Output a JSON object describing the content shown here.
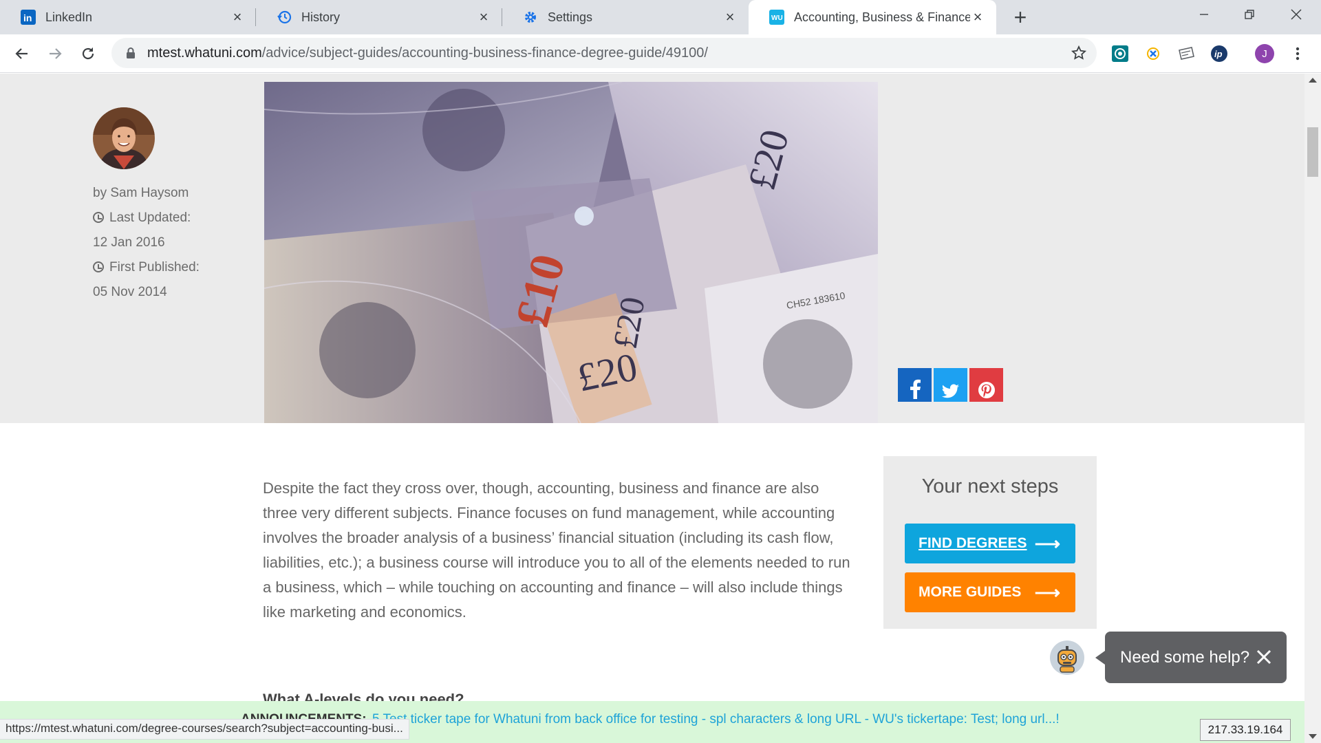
{
  "browser": {
    "tabs": [
      {
        "title": "LinkedIn",
        "icon": "linkedin-icon"
      },
      {
        "title": "History",
        "icon": "history-icon"
      },
      {
        "title": "Settings",
        "icon": "gear-icon"
      },
      {
        "title": "Accounting, Business & Finance D",
        "icon": "whatuni-icon"
      }
    ],
    "url_host": "mtest.whatuni.com",
    "url_path": "/advice/subject-guides/accounting-business-finance-degree-guide/49100/",
    "profile_initial": "J"
  },
  "author": {
    "byline": "by Sam Haysom",
    "last_updated_label": "Last Updated:",
    "last_updated": "12 Jan 2016",
    "first_published_label": "First Published:",
    "first_published": "05 Nov 2014"
  },
  "article": {
    "paragraph": "Despite the fact they cross over, though, accounting, business and finance are also three very different subjects. Finance focuses on fund management, while accounting involves the broader analysis of a business’ financial situation (including its cash flow, liabilities, etc.); a business course will introduce you to all of the elements needed to run a business, which – while touching on accounting and finance – will also include things like marketing and economics.",
    "next_heading_partial": "What A-levels do you need?"
  },
  "next_steps": {
    "title": "Your next steps",
    "find_degrees": "FIND DEGREES",
    "more_guides": "MORE GUIDES",
    "arrow": "⟶"
  },
  "help": {
    "text": "Need some help?"
  },
  "ticker": {
    "label": "ANNOUNCEMENTS:",
    "message": "5 Test ticker tape for Whatuni from back office for testing - spl characters & long URL - WU's tickertape: Test; long url...!"
  },
  "status": {
    "hover_url": "https://mtest.whatuni.com/degree-courses/search?subject=accounting-busi...",
    "ip": "217.33.19.164"
  },
  "colors": {
    "find_degrees": "#0ea5dd",
    "more_guides": "#ff8200",
    "facebook": "#1565c0",
    "twitter": "#1da1f2",
    "pinterest": "#e03c41"
  }
}
